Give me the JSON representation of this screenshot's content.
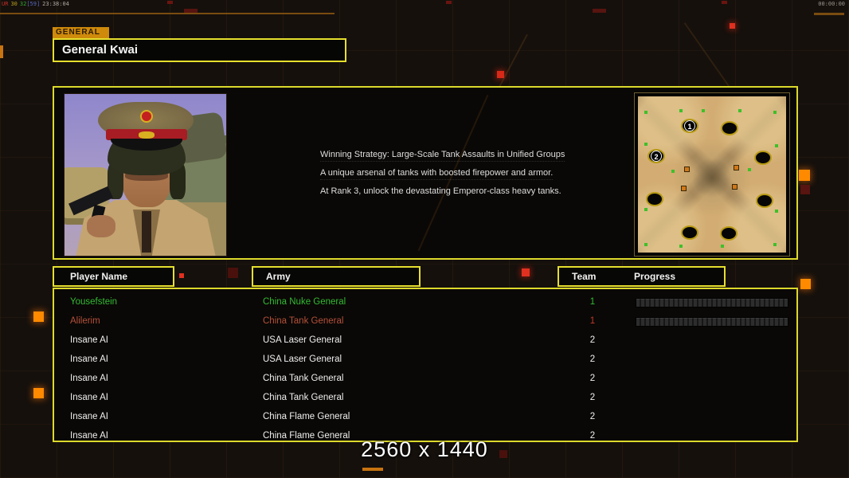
{
  "hud": {
    "debug": {
      "tag": "UR",
      "v1": "30",
      "v2": "32",
      "v3": "[59]",
      "clock": "23:38:04"
    },
    "match_timer": "00:00:00",
    "resolution_watermark": "2560 x 1440"
  },
  "general_panel": {
    "tab_label": "GENERAL",
    "general_name": "General Kwai",
    "strategy_lines": [
      "Winning Strategy: Large-Scale Tank Assaults in Unified Groups",
      "A unique arsenal of tanks with boosted firepower and armor.",
      "At Rank 3, unlock the devastating Emperor-class heavy tanks."
    ]
  },
  "map_preview": {
    "marker_1": "1",
    "marker_2": "2"
  },
  "player_table": {
    "headers": {
      "player_name": "Player Name",
      "army": "Army",
      "team": "Team",
      "progress": "Progress"
    },
    "rows": [
      {
        "name": "Yousefstein",
        "army": "China Nuke General",
        "team": "1"
      },
      {
        "name": "Alilerim",
        "army": "China Tank General",
        "team": "1"
      },
      {
        "name": "Insane AI",
        "army": "USA Laser General",
        "team": "2"
      },
      {
        "name": "Insane AI",
        "army": "USA Laser General",
        "team": "2"
      },
      {
        "name": "Insane AI",
        "army": "China Tank General",
        "team": "2"
      },
      {
        "name": "Insane AI",
        "army": "China Tank General",
        "team": "2"
      },
      {
        "name": "Insane AI",
        "army": "China Flame General",
        "team": "2"
      },
      {
        "name": "Insane AI",
        "army": "China Flame General",
        "team": "2"
      }
    ]
  },
  "colors": {
    "accent_yellow": "#dcd92c",
    "tab_orange": "#cf8a0b",
    "glow_orange": "#ff8a00",
    "alert_red": "#e03020",
    "human_player_green": "#33bb33",
    "human_player_salmon": "#b5503a",
    "ai_text_white": "#efefef"
  }
}
